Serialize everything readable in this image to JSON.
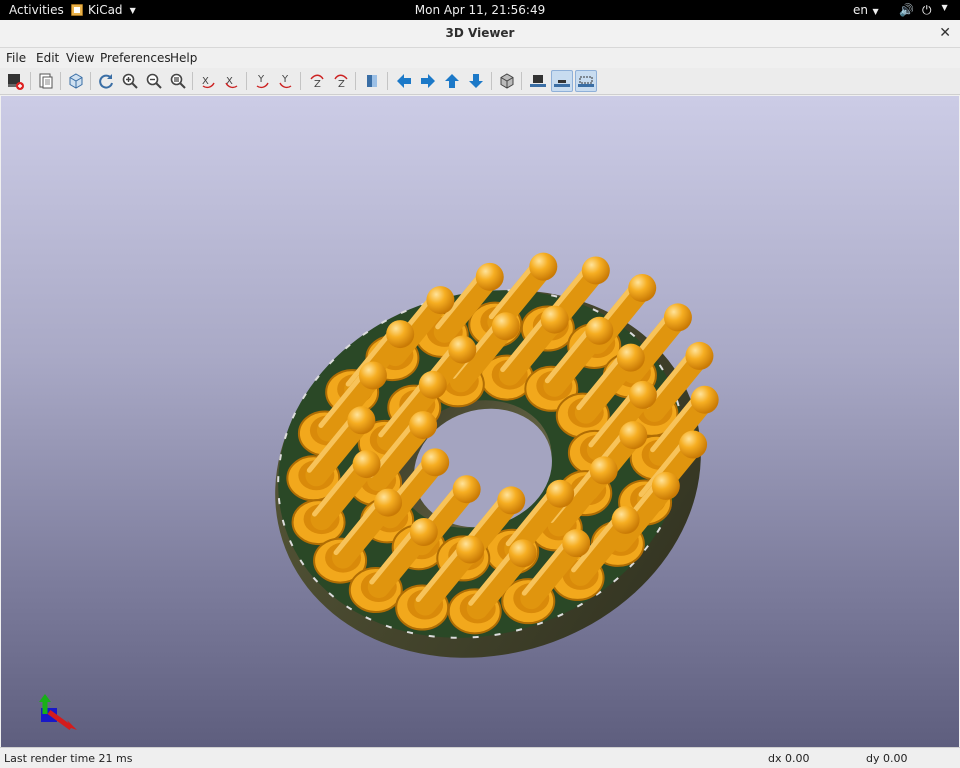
{
  "topbar": {
    "activities": "Activities",
    "app_name": "KiCad",
    "clock": "Mon Apr 11, 21:56:49",
    "language": "en"
  },
  "window": {
    "title": "3D Viewer"
  },
  "menubar": [
    "File",
    "Edit",
    "View",
    "Preferences",
    "Help"
  ],
  "toolbar": {
    "icons": [
      "render-raytracing-icon",
      "copy-clipboard-icon",
      "reload-board-icon",
      "refresh-view-icon",
      "zoom-in-icon",
      "zoom-out-icon",
      "zoom-fit-icon",
      "rotate-x-cw-icon",
      "rotate-x-ccw-icon",
      "rotate-y-cw-icon",
      "rotate-y-ccw-icon",
      "rotate-z-cw-icon",
      "rotate-z-ccw-icon",
      "flip-board-icon",
      "move-left-icon",
      "move-right-icon",
      "move-up-icon",
      "move-down-icon",
      "ortho-view-icon",
      "show-tht-models-icon",
      "show-smd-models-icon",
      "show-virtual-models-icon"
    ]
  },
  "status": {
    "render_time": "Last render time 21 ms",
    "dx": "dx 0.00",
    "dy": "dy 0.00"
  },
  "colors": {
    "pin_gold": "#f2a81c",
    "pcb_green": "#2b4a28",
    "board_body": "#45452c",
    "background_top": "#cccce6",
    "background_bottom": "#5e5e7e"
  }
}
